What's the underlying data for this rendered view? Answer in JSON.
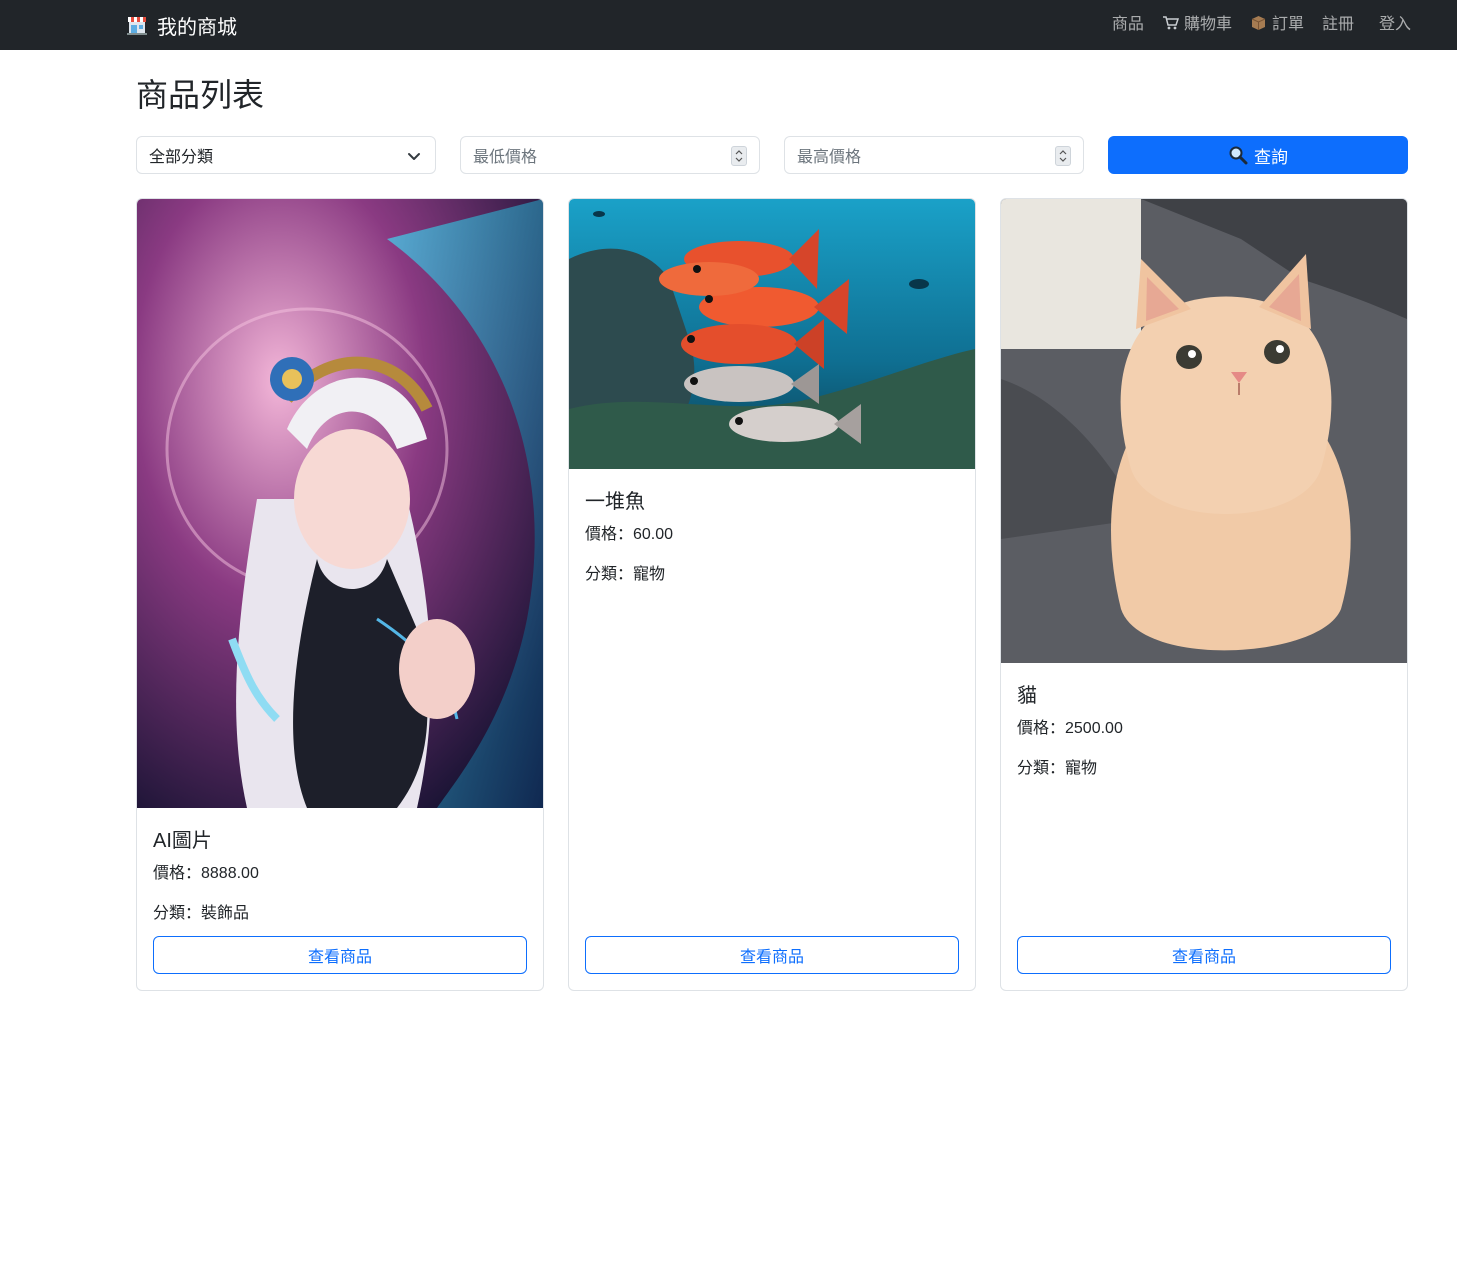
{
  "nav": {
    "brand": "我的商城",
    "links": {
      "products": "商品",
      "cart": "購物車",
      "orders": "訂單",
      "register": "註冊",
      "login": "登入"
    }
  },
  "page": {
    "title": "商品列表"
  },
  "filters": {
    "category_selected": "全部分類",
    "min_price_placeholder": "最低價格",
    "max_price_placeholder": "最高價格",
    "search_label": "查詢"
  },
  "products": [
    {
      "name": "AI圖片",
      "price": "價格：8888.00",
      "category": "分類：裝飾品",
      "button": "查看商品",
      "image": "anime-fantasy-girl"
    },
    {
      "name": "一堆魚",
      "price": "價格：60.00",
      "category": "分類：寵物",
      "button": "查看商品",
      "image": "red-fish-underwater"
    },
    {
      "name": "貓",
      "price": "價格：2500.00",
      "category": "分類：寵物",
      "button": "查看商品",
      "image": "cream-cat-on-sofa"
    }
  ],
  "colors": {
    "navbar": "#212529",
    "primary": "#0d6efd",
    "border": "#dee2e6",
    "muted": "#6c757d"
  }
}
